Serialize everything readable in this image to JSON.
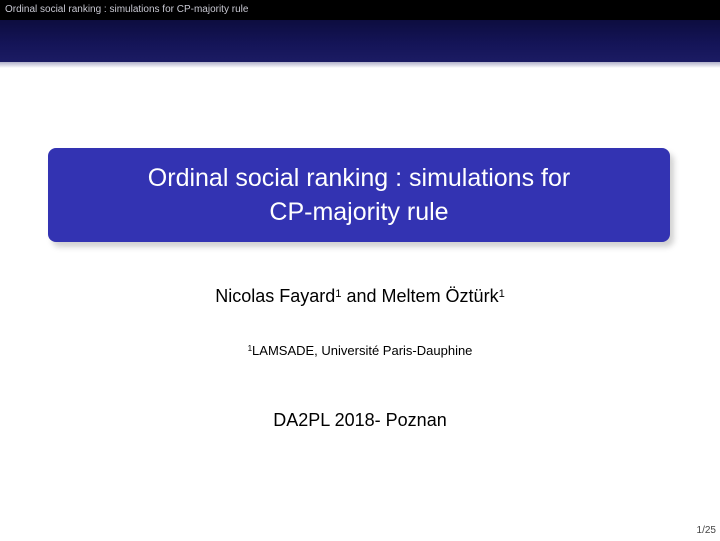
{
  "headline": {
    "short_title": "Ordinal social ranking : simulations for CP-majority rule"
  },
  "title": {
    "line1": "Ordinal social ranking : simulations for",
    "line2": "CP-majority rule"
  },
  "authors": {
    "author1": "Nicolas Fayard",
    "author1_mark": "1",
    "connector": "and",
    "author2": "Meltem Öztürk",
    "author2_mark": "1"
  },
  "affiliation": {
    "mark": "1",
    "text": "LAMSADE, Université Paris-Dauphine"
  },
  "event": "DA2PL 2018- Poznan",
  "page_number": "1/25"
}
